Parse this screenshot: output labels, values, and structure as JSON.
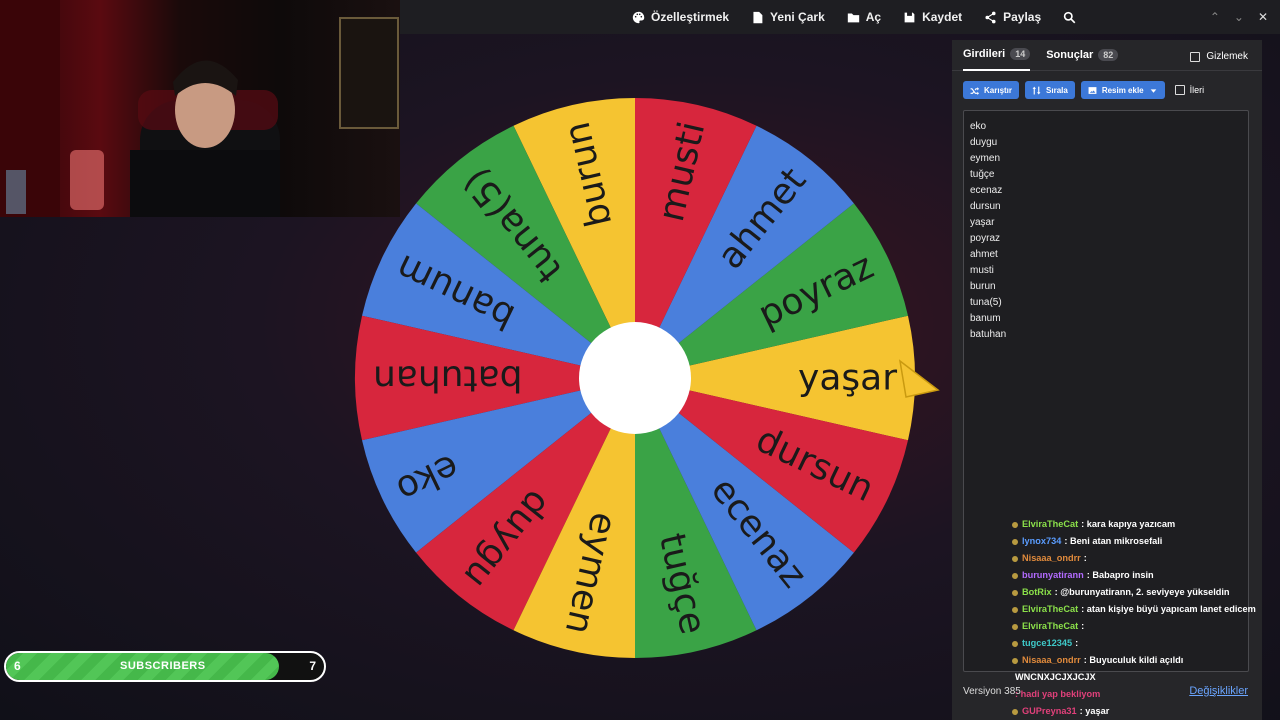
{
  "toolbar": {
    "items": [
      {
        "label": "Özelleştirmek",
        "icon": "palette-icon"
      },
      {
        "label": "Yeni Çark",
        "icon": "document-icon"
      },
      {
        "label": "Aç",
        "icon": "folder-icon"
      },
      {
        "label": "Kaydet",
        "icon": "save-icon"
      },
      {
        "label": "Paylaş",
        "icon": "share-icon"
      }
    ],
    "search_icon": "search-icon",
    "window_controls": [
      "chevron-up-icon",
      "chevron-down-icon",
      "close-icon"
    ]
  },
  "wheel": {
    "segments": [
      {
        "label": "yaşar",
        "color": "#f5c431"
      },
      {
        "label": "poyraz",
        "color": "#3aa346"
      },
      {
        "label": "ahmet",
        "color": "#4a7fdc"
      },
      {
        "label": "musti",
        "color": "#d7263d"
      },
      {
        "label": "burun",
        "color": "#f5c431"
      },
      {
        "label": "tuna(5)",
        "color": "#3aa346"
      },
      {
        "label": "banum",
        "color": "#4a7fdc"
      },
      {
        "label": "batuhan",
        "color": "#d7263d"
      },
      {
        "label": "eko",
        "color": "#4a7fdc"
      },
      {
        "label": "duygu",
        "color": "#d7263d"
      },
      {
        "label": "eymen",
        "color": "#f5c431"
      },
      {
        "label": "tuğçe",
        "color": "#3aa346"
      },
      {
        "label": "ecenaz",
        "color": "#4a7fdc"
      },
      {
        "label": "dursun",
        "color": "#d7263d"
      }
    ],
    "pointer_icon": "pointer-arrow-icon"
  },
  "panel": {
    "tabs": [
      {
        "label": "Girdileri",
        "count": "14"
      },
      {
        "label": "Sonuçlar",
        "count": "82"
      }
    ],
    "hide_label": "Gizlemek",
    "buttons": [
      {
        "label": "Karıştır",
        "icon": "shuffle-icon"
      },
      {
        "label": "Sırala",
        "icon": "sort-icon"
      },
      {
        "label": "Resim ekle",
        "icon": "image-icon"
      }
    ],
    "advanced_label": "İleri",
    "entries": [
      "eko",
      "duygu",
      "eymen",
      "tuğçe",
      "ecenaz",
      "dursun",
      "yaşar",
      "poyraz",
      "ahmet",
      "musti",
      "burun",
      "tuna(5)",
      "banum",
      "batuhan"
    ],
    "version": "Versiyon 385",
    "changes_link": "Değişiklikler"
  },
  "chat": [
    {
      "user": "ElviraTheCat",
      "color": "#8be04a",
      "text": ": kara kapıya yazıcam"
    },
    {
      "user": "lynox734",
      "color": "#5a9cff",
      "text": ": Beni atan mikrosefali"
    },
    {
      "user": "Nisaaa_ondrr",
      "color": "#e08a3c",
      "text": ":"
    },
    {
      "user": "burunyatirann",
      "color": "#b36bff",
      "text": ": Babapro insin"
    },
    {
      "user": "BotRix",
      "color": "#8be04a",
      "text": ": @burunyatirann, 2. seviyeye yükseldin"
    },
    {
      "user": "ElviraTheCat",
      "color": "#8be04a",
      "text": ": atan kişiye büyü yapıcam lanet edicem"
    },
    {
      "user": "ElviraTheCat",
      "color": "#8be04a",
      "text": ":"
    },
    {
      "user": "tugce12345",
      "color": "#3ec9c9",
      "text": ":"
    },
    {
      "user": "Nisaaa_ondrr",
      "color": "#e08a3c",
      "text": ": Buyuculuk kildi açıldı"
    },
    {
      "user": "",
      "color": "#ffffff",
      "text": "WNCNXJCJXJCJX"
    },
    {
      "user": "",
      "color": "#e0407a",
      "text": ": hadi yap bekliyom"
    },
    {
      "user": "GUPreyna31",
      "color": "#e0407a",
      "text": ": yaşar"
    }
  ],
  "subscribers": {
    "current": "6",
    "label": "SUBSCRIBERS",
    "goal": "7",
    "progress": 0.857
  }
}
